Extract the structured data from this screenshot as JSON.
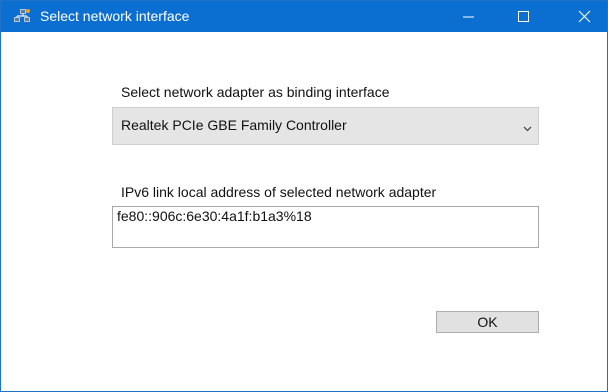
{
  "window": {
    "title": "Select network interface",
    "accent_color": "#0b6fd1",
    "icon": "network-app-icon",
    "controls": {
      "minimize_icon": "minimize-icon",
      "maximize_icon": "maximize-icon",
      "close_icon": "close-icon"
    }
  },
  "adapter": {
    "label": "Select network adapter as binding interface",
    "selected": "Realtek PCIe GBE Family Controller",
    "dropdown_icon": "chevron-down-icon"
  },
  "ipv6": {
    "label": "IPv6 link local address of selected network adapter",
    "value": "fe80::906c:6e30:4a1f:b1a3%18"
  },
  "buttons": {
    "ok_label": "OK"
  }
}
